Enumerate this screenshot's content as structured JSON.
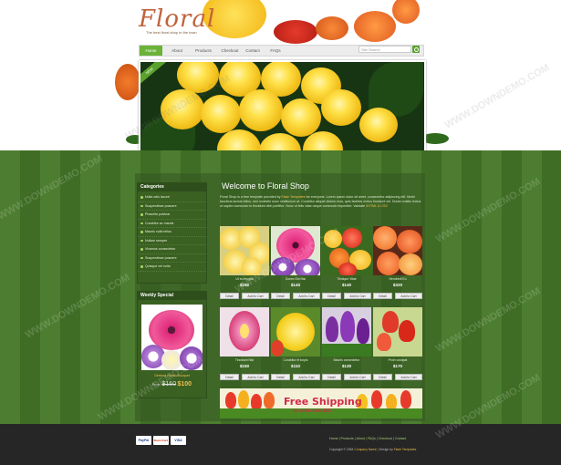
{
  "brand": {
    "logo_text": "Floral",
    "tagline": "The best floral shop in the town",
    "accent": "#6ab338",
    "stripe_dark": "#3f6d25",
    "stripe_light": "#4d7d30"
  },
  "nav": {
    "items": [
      {
        "label": "Home",
        "active": true
      },
      {
        "label": "About",
        "active": false
      },
      {
        "label": "Products",
        "active": false
      },
      {
        "label": "Checkout",
        "active": false
      },
      {
        "label": "Contact",
        "active": false
      },
      {
        "label": "FAQs",
        "active": false
      }
    ],
    "search_placeholder": "Site Search"
  },
  "banner": {
    "ribbon": "NEW"
  },
  "categories": {
    "title": "Categories",
    "items": [
      "Nulla odio lacunt",
      "Suspendisse posuere",
      "Phasella pulvinar",
      "Curabitur ac mauris",
      "Mauris nulla tellus",
      "Nullam semper",
      "Vivamus consectetur",
      "Suspendisse posuere",
      "Quisque vel nulla"
    ]
  },
  "weekly_special": {
    "title": "Weekly Special",
    "name": "Gerbera Bunch Bouquet",
    "price_label": "Price:",
    "old_price": "$160",
    "new_price": "$100"
  },
  "main": {
    "title": "Welcome to Floral Shop",
    "intro_lead": "Floral Shop is a free template provided by",
    "intro_link": "Flash Templates",
    "intro_rest": "for everyone. Lorem ipsum dolor sit amet, consectetur adipiscing elit. Morbi faucibus lacinia tellus, sed molestie nunc vestibulum at. Curabitur aliquet dictum eros, quis facilisis metus tincidunt vel. Donec mattis lectus ut sapien commodo in tincidunt nibh porttitor. Nunc ut felis vitae neque commodo imperdiet.",
    "validate_label": "Validate",
    "validate_link": "XHTML & CSS"
  },
  "products": [
    {
      "name": "Ut eu feugiat",
      "price": "$160",
      "detail": "Detail",
      "add": "Add to Cart"
    },
    {
      "name": "Donec Est Nisi",
      "price": "$140",
      "detail": "Detail",
      "add": "Add to Cart"
    },
    {
      "name": "Tristique Vitae",
      "price": "$140",
      "detail": "Detail",
      "add": "Add to Cart"
    },
    {
      "name": "Hendrerit Eu",
      "price": "$320",
      "detail": "Detail",
      "add": "Add to Cart"
    },
    {
      "name": "Tincidunt Nisi",
      "price": "$150",
      "detail": "Detail",
      "add": "Add to Cart"
    },
    {
      "name": "Curabitur et turpis",
      "price": "$110",
      "detail": "Detail",
      "add": "Add to Cart"
    },
    {
      "name": "Mauris consectetur",
      "price": "$130",
      "detail": "Detail",
      "add": "Add to Cart"
    },
    {
      "name": "Proin volutpat",
      "price": "$170",
      "detail": "Detail",
      "add": "Add to Cart"
    }
  ],
  "shipping": {
    "headline": "Free Shipping",
    "sub": "on order over $25"
  },
  "footer": {
    "links": [
      "Home",
      "Products",
      "About",
      "FAQs",
      "Checkout",
      "Contact"
    ],
    "separator": "|",
    "copyright_lead": "Copyright © 2084",
    "company": "Company Name",
    "designed_label": "Design by",
    "designer": "Flash Templates",
    "payments": [
      "PayPal",
      "MasterCard",
      "VISA"
    ]
  },
  "watermark": "WWW.DOWNDEMO.COM"
}
